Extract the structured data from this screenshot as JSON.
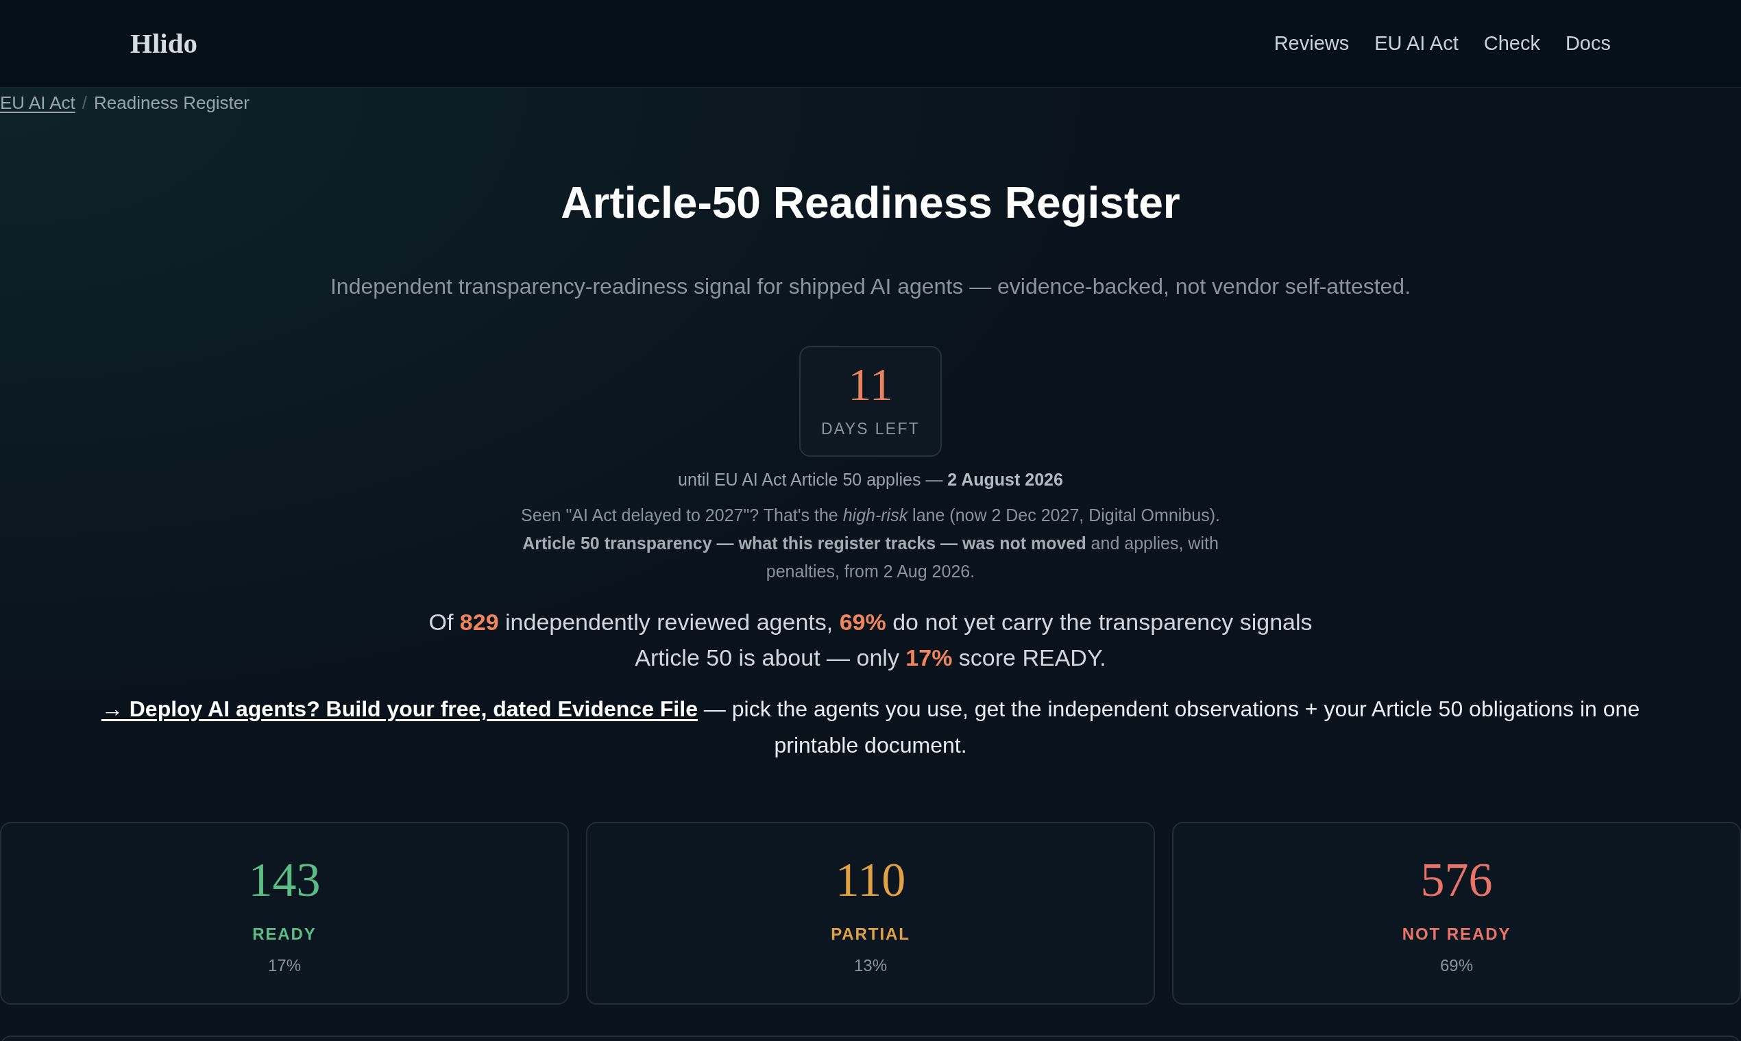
{
  "header": {
    "logo": "Hlido",
    "nav": [
      {
        "label": "Reviews"
      },
      {
        "label": "EU AI Act"
      },
      {
        "label": "Check"
      },
      {
        "label": "Docs"
      }
    ]
  },
  "breadcrumb": {
    "items": [
      {
        "label": "EU AI Act",
        "kind": "link"
      },
      {
        "label": "Readiness Register",
        "kind": "current"
      }
    ],
    "separator": "/"
  },
  "title": "Article-50 Readiness Register",
  "subtitle": "Independent transparency-readiness signal for shipped AI agents — evidence-backed, not vendor self-attested.",
  "countdown": {
    "value": "11",
    "label": "DAYS LEFT"
  },
  "deadline_note": "until EU AI Act Article 50 applies — **2 August 2026**",
  "delay_note": "Seen \"AI Act delayed to 2027\"? That's the *high-risk* lane (now 2 Dec 2027, Digital Omnibus). **Article 50 transparency — what this register tracks — was not moved** and applies, with penalties, from 2 Aug 2026.",
  "summary": "Of **829** independently reviewed agents, **69%** do not yet carry the transparency signals Article 50 is about — only **17%** score READY.",
  "cta": {
    "link": "→ Deploy AI agents? Build your free, dated Evidence File",
    "text": " — pick the agents you use, get the independent observations + your Article 50 obligations in one printable document."
  },
  "tiers": [
    {
      "count": "143",
      "label": "READY",
      "share": "17%",
      "color": "#5bbd84"
    },
    {
      "count": "110",
      "label": "PARTIAL",
      "share": "13%",
      "color": "#e0a243"
    },
    {
      "count": "576",
      "label": "NOT READY",
      "share": "69%",
      "color": "#ea7467"
    }
  ]
}
